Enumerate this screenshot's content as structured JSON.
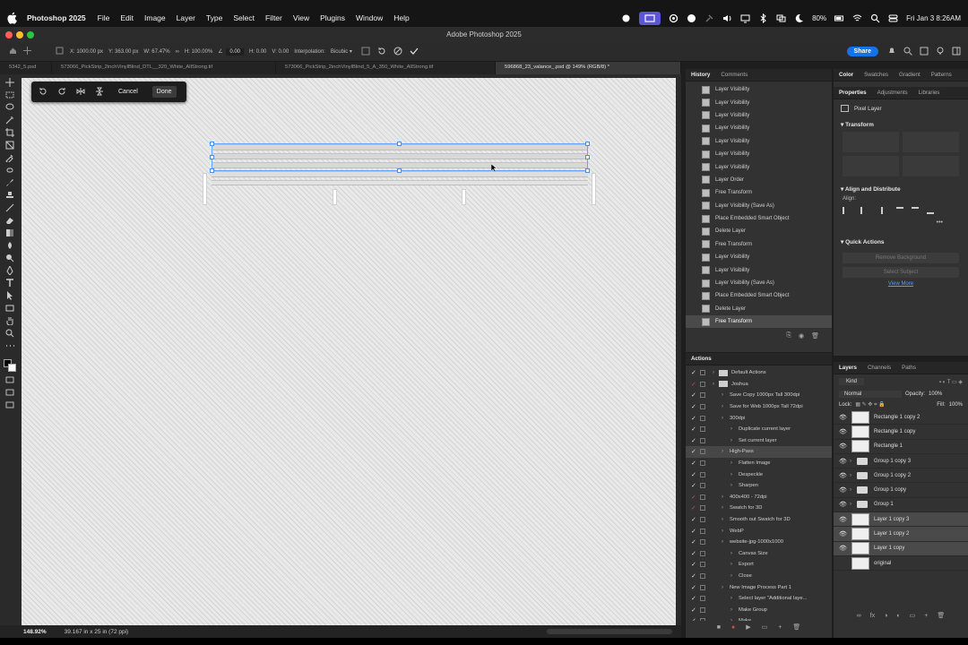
{
  "menubar": {
    "items": [
      "Photoshop 2025",
      "File",
      "Edit",
      "Image",
      "Layer",
      "Type",
      "Select",
      "Filter",
      "View",
      "Plugins",
      "Window",
      "Help"
    ],
    "battery": "80%",
    "datetime": "Fri Jan 3  8:26AM"
  },
  "window": {
    "title": "Adobe Photoshop 2025"
  },
  "options": {
    "x": "X: 1000.00 px",
    "y": "Y: 363.00 px",
    "w": "W: 67.47%",
    "h": "H: 100.00%",
    "angle": "0.00",
    "hskew": "H: 0.00",
    "vskew": "V: 0.00",
    "interpolation_label": "Interpolation:",
    "interpolation_value": "Bicubic",
    "share": "Share"
  },
  "tabs": [
    "5342_5.psd",
    "573066_PickStrip_2inchVinylBlind_DTL__320_White_AllStrong.tif",
    "573066_PickStrip_2inchVinylBlind_5_A_350_White_AllStrong.tif",
    "596868_23_valance_.psd @ 149% (RGB/8) *"
  ],
  "transform_bar": {
    "cancel": "Cancel",
    "done": "Done"
  },
  "status": {
    "zoom": "148.92%",
    "doc": "39.167 in x 25 in (72 ppi)"
  },
  "history": {
    "tabs": [
      "History",
      "Comments"
    ],
    "items": [
      "Layer Visibility",
      "Layer Visibility",
      "Layer Visibility",
      "Layer Visibility",
      "Layer Visibility",
      "Layer Visibility",
      "Layer Visibility",
      "Layer Order",
      "Free Transform",
      "Layer Visibility (Save As)",
      "Place Embedded Smart Object",
      "Delete Layer",
      "Free Transform",
      "Layer Visibility",
      "Layer Visibility",
      "Layer Visibility (Save As)",
      "Place Embedded Smart Object",
      "Delete Layer",
      "Free Transform"
    ]
  },
  "right_panel": {
    "tabs": [
      "Color",
      "Swatches",
      "Gradient",
      "Patterns"
    ],
    "prop_tabs": [
      "Properties",
      "Adjustments",
      "Libraries"
    ],
    "pixel_layer": "Pixel Layer",
    "transform": "Transform",
    "align": "Align and Distribute",
    "align_sub": "Align:",
    "quick_actions": "Quick Actions",
    "remove_bg": "Remove Background",
    "select_subject": "Select Subject",
    "view_more": "View More"
  },
  "actions": {
    "title": "Actions",
    "items": [
      {
        "label": "Default Actions",
        "indent": 0
      },
      {
        "label": "Joshua",
        "indent": 0
      },
      {
        "label": "Save Copy 1000px Tall 300dpi",
        "indent": 1
      },
      {
        "label": "Save for Web 1000px Tall 72dpi",
        "indent": 1
      },
      {
        "label": "300dpi",
        "indent": 1
      },
      {
        "label": "Duplicate current layer",
        "indent": 2
      },
      {
        "label": "Set current layer",
        "indent": 2
      },
      {
        "label": "High-Pass",
        "indent": 1
      },
      {
        "label": "Flatten Image",
        "indent": 2
      },
      {
        "label": "Despeckle",
        "indent": 2
      },
      {
        "label": "Sharpen",
        "indent": 2
      },
      {
        "label": "400x400 - 72dpi",
        "indent": 1
      },
      {
        "label": "Swatch for 3D",
        "indent": 1
      },
      {
        "label": "Smooth out Swatch for 3D",
        "indent": 1
      },
      {
        "label": "WebP",
        "indent": 1
      },
      {
        "label": "website-jpg-1000x1000",
        "indent": 1
      },
      {
        "label": "Canvas Size",
        "indent": 2
      },
      {
        "label": "Export",
        "indent": 2
      },
      {
        "label": "Close",
        "indent": 2
      },
      {
        "label": "New Image Process Part 1",
        "indent": 1
      },
      {
        "label": "Select layer \"Additional laye...",
        "indent": 2
      },
      {
        "label": "Make Group",
        "indent": 2
      },
      {
        "label": "Make",
        "indent": 2
      }
    ]
  },
  "layers": {
    "tabs": [
      "Layers",
      "Channels",
      "Paths"
    ],
    "kind": "Kind",
    "blend": "Normal",
    "opacity_label": "Opacity:",
    "opacity": "100%",
    "lock_label": "Lock:",
    "fill_label": "Fill:",
    "fill": "100%",
    "items": [
      {
        "name": "Rectangle 1 copy 2",
        "type": "shape"
      },
      {
        "name": "Rectangle 1 copy",
        "type": "shape"
      },
      {
        "name": "Rectangle 1",
        "type": "shape"
      },
      {
        "name": "Group 1 copy 3",
        "type": "group"
      },
      {
        "name": "Group 1 copy 2",
        "type": "group"
      },
      {
        "name": "Group 1 copy",
        "type": "group"
      },
      {
        "name": "Group 1",
        "type": "group"
      },
      {
        "name": "Layer 1 copy 3",
        "type": "pixel"
      },
      {
        "name": "Layer 1 copy 2",
        "type": "pixel"
      },
      {
        "name": "Layer 1 copy",
        "type": "pixel"
      },
      {
        "name": "original",
        "type": "pixel"
      }
    ]
  },
  "tools": [
    "move-icon",
    "marquee-icon",
    "lasso-icon",
    "magic-wand-icon",
    "crop-icon",
    "frame-icon",
    "eyedropper-icon",
    "healing-icon",
    "brush-icon",
    "clone-stamp-icon",
    "history-brush-icon",
    "eraser-icon",
    "gradient-icon",
    "blur-icon",
    "dodge-icon",
    "pen-icon",
    "type-icon",
    "path-select-icon",
    "rectangle-icon",
    "hand-icon",
    "zoom-icon",
    "more-icon"
  ]
}
